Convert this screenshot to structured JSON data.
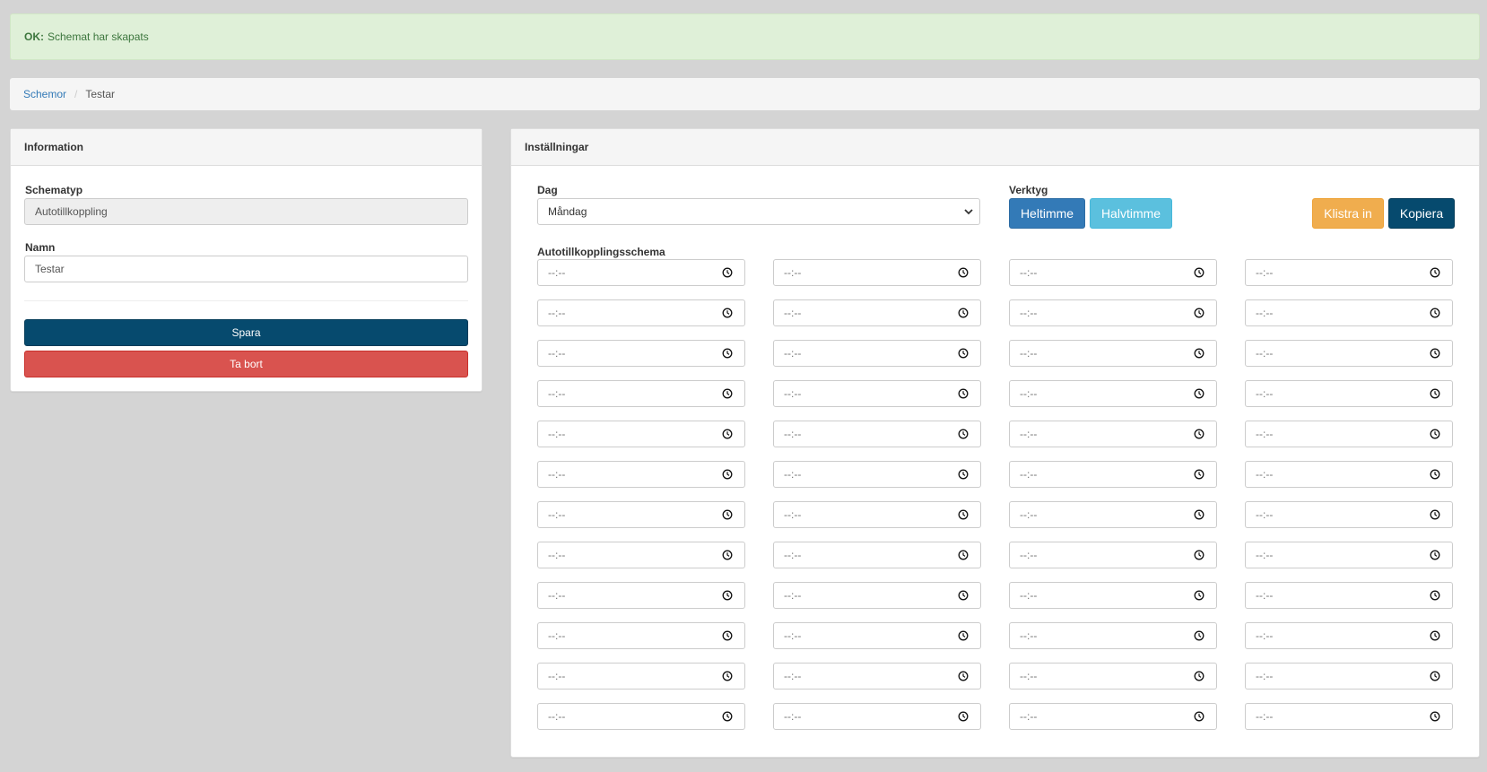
{
  "alert": {
    "prefix": "OK:",
    "message": "Schemat har skapats",
    "color": "#3c763d",
    "background": "#dff0d8"
  },
  "breadcrumb": {
    "link": "Schemor",
    "separator": "/",
    "current": "Testar"
  },
  "info_panel": {
    "title": "Information",
    "schematyp_label": "Schematyp",
    "schematyp_value": "Autotillkoppling",
    "namn_label": "Namn",
    "namn_value": "Testar",
    "save_label": "Spara",
    "delete_label": "Ta bort"
  },
  "settings_panel": {
    "title": "Inställningar",
    "dag_label": "Dag",
    "dag_value": "Måndag",
    "verktyg_label": "Verktyg",
    "heltimme_label": "Heltimme",
    "halvtimme_label": "Halvtimme",
    "paste_label": "Klistra in",
    "copy_label": "Kopiera",
    "schedule_label": "Autotillkopplingsschema",
    "time_placeholder": "--:--",
    "rows": 12,
    "columns": 4
  },
  "colors": {
    "primary_dark": "#064a6e",
    "danger": "#d9534f",
    "primary": "#337ab7",
    "info": "#5bc0de",
    "warning": "#f0ad4e"
  }
}
